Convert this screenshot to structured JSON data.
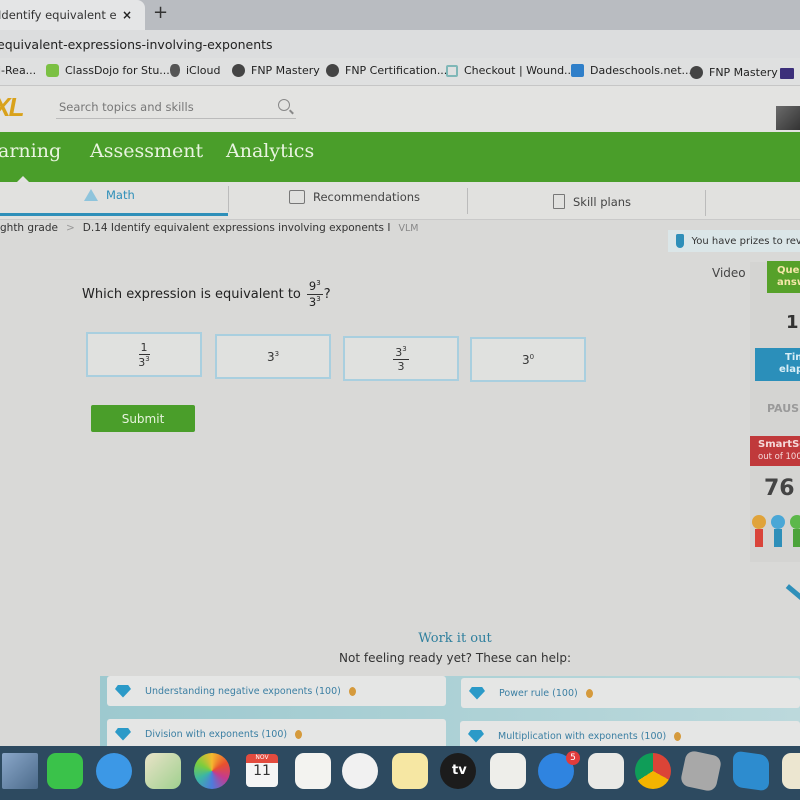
{
  "browser": {
    "tab_title": "Identify equivalent expres",
    "tab_close": "×",
    "new_tab": "+",
    "url": "equivalent-expressions-involving-exponents",
    "bookmarks": [
      {
        "label": "i-Rea...",
        "icon": "generic-icon"
      },
      {
        "label": "ClassDojo for Stu...",
        "icon": "classdojo-icon"
      },
      {
        "label": "iCloud",
        "icon": "apple-icon"
      },
      {
        "label": "FNP Mastery",
        "icon": "globe-icon"
      },
      {
        "label": "FNP Certification...",
        "icon": "globe-icon"
      },
      {
        "label": "Checkout | Wound...",
        "icon": "plus-icon"
      },
      {
        "label": "Dadeschools.net...",
        "icon": "dadeschools-icon"
      },
      {
        "label": "FNP Mastery",
        "icon": "globe-icon"
      },
      {
        "label": "",
        "icon": "mail-icon"
      }
    ]
  },
  "ixl": {
    "logo": "IXL",
    "search_placeholder": "Search topics and skills",
    "nav": [
      "Learning",
      "Assessment",
      "Analytics"
    ],
    "nav_visible": [
      "arning",
      "Assessment",
      "Analytics"
    ],
    "subnav": [
      {
        "label": "Math",
        "icon": "pyramid-icon",
        "active": true
      },
      {
        "label": "Recommendations",
        "icon": "signpost-icon",
        "active": false
      },
      {
        "label": "Skill plans",
        "icon": "clipboard-icon",
        "active": false
      }
    ],
    "breadcrumb": {
      "grade": "ghth grade",
      "separator": ">",
      "skill": "D.14 Identify equivalent expressions involving exponents I",
      "code": "VLM"
    },
    "prizes_text": "You have prizes to reve"
  },
  "question": {
    "prompt": "Which expression is equivalent to",
    "expression": {
      "num_base": "9",
      "num_exp": "3",
      "den_base": "3",
      "den_exp": "3"
    },
    "qmark": "?",
    "choices": [
      {
        "type": "fraction",
        "num": "1",
        "den_base": "3",
        "den_exp": "3"
      },
      {
        "type": "power",
        "base": "3",
        "exp": "3"
      },
      {
        "type": "fraction-power-num",
        "num_base": "3",
        "num_exp": "3",
        "den": "3"
      },
      {
        "type": "power",
        "base": "3",
        "exp": "0"
      }
    ],
    "submit_label": "Submit"
  },
  "sidebar": {
    "video_label": "Video",
    "questions_answered_label": "Que\nansw",
    "questions_answered_label_l1": "Que",
    "questions_answered_label_l2": "answ",
    "questions_answered_value": "1",
    "time_elapsed_l1": "Tim",
    "time_elapsed_l2": "elaps",
    "pause_label": "PAUS",
    "smartscore_l1": "SmartSc",
    "smartscore_l2": "out of 100",
    "smartscore_value": "76",
    "ribbon_colors": [
      "#d9443a",
      "#2e8fb9",
      "#4ca33a"
    ]
  },
  "work_it_out": {
    "title": "Work it out",
    "subtitle": "Not feeling ready yet? These can help:",
    "skills": [
      {
        "label": "Understanding negative exponents (100)"
      },
      {
        "label": "Power rule (100)"
      },
      {
        "label": "Division with exponents (100)"
      },
      {
        "label": "Multiplication with exponents (100)"
      }
    ]
  },
  "dock": {
    "apps": [
      "Mail",
      "FaceTime",
      "Messages",
      "Maps",
      "Photos",
      "Calendar",
      "Reminders",
      "Music",
      "Notes",
      "TV",
      "Numbers",
      "App Store",
      "Keynote",
      "Chrome",
      "Roblox",
      "Screens",
      "Script Editor"
    ],
    "calendar_month": "NOV",
    "calendar_day": "11",
    "tv_label": "tv",
    "appstore_badge": "5"
  }
}
